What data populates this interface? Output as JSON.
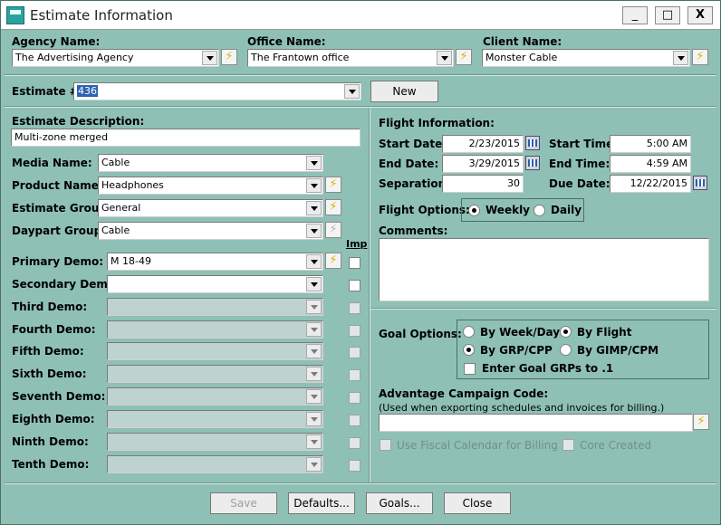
{
  "window": {
    "title": "Estimate Information",
    "buttons": [
      "_",
      "□",
      "X"
    ]
  },
  "top": {
    "agency": {
      "label": "Agency Name:",
      "value": "The Advertising Agency"
    },
    "office": {
      "label": "Office Name:",
      "value": "The Frantown office"
    },
    "client": {
      "label": "Client Name:",
      "value": "Monster Cable"
    }
  },
  "estimate": {
    "label": "Estimate #:",
    "value": "436",
    "new_button": "New"
  },
  "left": {
    "description_label": "Estimate Description:",
    "description_value": "Multi-zone merged",
    "media_label": "Media Name:",
    "media_value": "Cable",
    "product_label": "Product Name:",
    "product_value": "Headphones",
    "group_label": "Estimate Group:",
    "group_value": "General",
    "daypart_label": "Daypart Group:",
    "daypart_value": "Cable",
    "imp_label": "Imp",
    "demos": [
      {
        "label": "Primary Demo:",
        "value": "M 18-49"
      },
      {
        "label": "Secondary Demo:",
        "value": ""
      },
      {
        "label": "Third Demo:",
        "value": ""
      },
      {
        "label": "Fourth Demo:",
        "value": ""
      },
      {
        "label": "Fifth Demo:",
        "value": ""
      },
      {
        "label": "Sixth Demo:",
        "value": ""
      },
      {
        "label": "Seventh Demo:",
        "value": ""
      },
      {
        "label": "Eighth Demo:",
        "value": ""
      },
      {
        "label": "Ninth Demo:",
        "value": ""
      },
      {
        "label": "Tenth Demo:",
        "value": ""
      }
    ]
  },
  "flight": {
    "title": "Flight Information:",
    "start_date_label": "Start Date:",
    "start_date": "2/23/2015",
    "end_date_label": "End Date:",
    "end_date": "3/29/2015",
    "separation_label": "Separation:",
    "separation": "30",
    "start_time_label": "Start Time:",
    "start_time": "5:00 AM",
    "end_time_label": "End Time:",
    "end_time": "4:59 AM",
    "due_date_label": "Due Date:",
    "due_date": "12/22/2015",
    "options_label": "Flight Options:",
    "weekly": "Weekly",
    "daily": "Daily",
    "comments_label": "Comments:",
    "comments": ""
  },
  "goal": {
    "label": "Goal Options:",
    "by_week_day": "By Week/Day",
    "by_flight": "By Flight",
    "by_grp_cpp": "By GRP/CPP",
    "by_gimp_cpm": "By GIMP/CPM",
    "enter_goal": "Enter Goal GRPs to .1"
  },
  "campaign": {
    "label": "Advantage Campaign Code:",
    "note": "(Used when exporting schedules and invoices for billing.)",
    "value": "",
    "fiscal": "Use Fiscal Calendar for Billing",
    "core": "Core Created"
  },
  "footer": {
    "save": "Save",
    "defaults": "Defaults...",
    "goals": "Goals...",
    "close": "Close"
  }
}
